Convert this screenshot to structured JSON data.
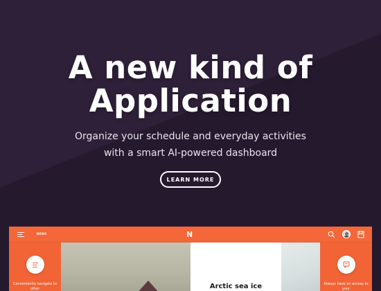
{
  "hero": {
    "title_line1": "A new kind of",
    "title_line2": "Application",
    "subtitle": "Organize your schedule and everyday activities with a smart AI-powered dashboard",
    "cta_label": "LEARN MORE"
  },
  "app_preview": {
    "nav_label": "NEWS",
    "logo_text": "N",
    "left_panel_text": "Conveniently navigate to other",
    "right_panel_text": "Always have an access to your",
    "card_title": "Arctic sea ice",
    "icons": [
      "menu-icon",
      "search-icon",
      "avatar",
      "bookmark-icon",
      "list-icon",
      "chat-icon"
    ]
  },
  "colors": {
    "background": "#2e2038",
    "accent": "#f26436",
    "text": "#ffffff"
  }
}
